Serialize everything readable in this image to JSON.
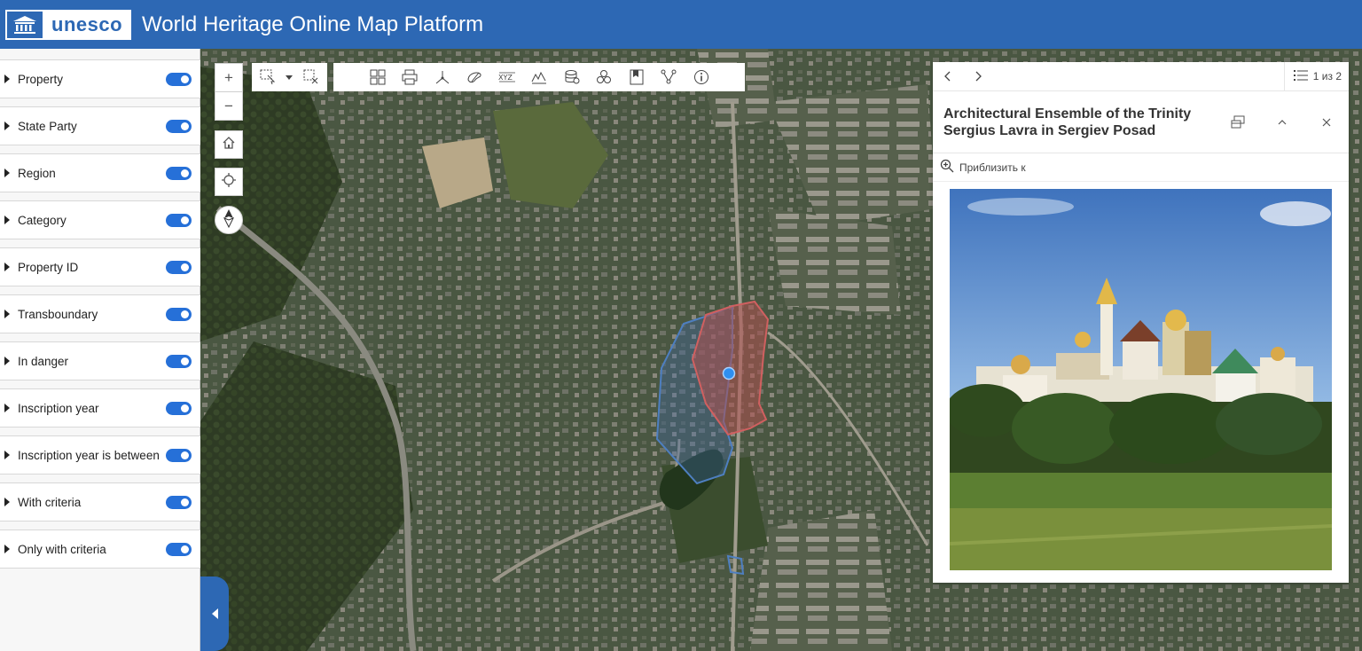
{
  "header": {
    "logo_text": "unesco",
    "title": "World Heritage Online Map Platform"
  },
  "sidebar": {
    "filters": [
      {
        "label": "Property",
        "enabled": true
      },
      {
        "label": "State Party",
        "enabled": true
      },
      {
        "label": "Region",
        "enabled": true
      },
      {
        "label": "Category",
        "enabled": true
      },
      {
        "label": "Property ID",
        "enabled": true
      },
      {
        "label": "Transboundary",
        "enabled": true
      },
      {
        "label": "In danger",
        "enabled": true
      },
      {
        "label": "Inscription year",
        "enabled": true
      },
      {
        "label": "Inscription year is between",
        "enabled": true
      },
      {
        "label": "With criteria",
        "enabled": true
      },
      {
        "label": "Only with criteria",
        "enabled": true
      }
    ],
    "collapse_icon": "chevron-left-icon"
  },
  "map_controls": {
    "zoom_in": "+",
    "zoom_out": "−",
    "home_icon": "home-icon",
    "locate_icon": "locate-icon",
    "compass_icon": "compass-icon"
  },
  "toolbar": {
    "selection_tools": [
      "select-icon",
      "dropdown-icon",
      "clear-selection-icon"
    ],
    "tools": [
      "basemap-gallery-icon",
      "print-icon",
      "measure-icon",
      "sketch-icon",
      "coordinates-icon",
      "elevation-profile-icon",
      "layer-list-icon",
      "analysis-icon",
      "bookmark-icon",
      "share-icon",
      "info-icon"
    ]
  },
  "popup": {
    "count": "1 из 2",
    "title": "Architectural Ensemble of the Trinity Sergius Lavra in Sergiev Posad",
    "zoom_to": "Приблизить к",
    "colors": {
      "accent": "#2d68b4",
      "toggle": "#2670d8"
    }
  }
}
